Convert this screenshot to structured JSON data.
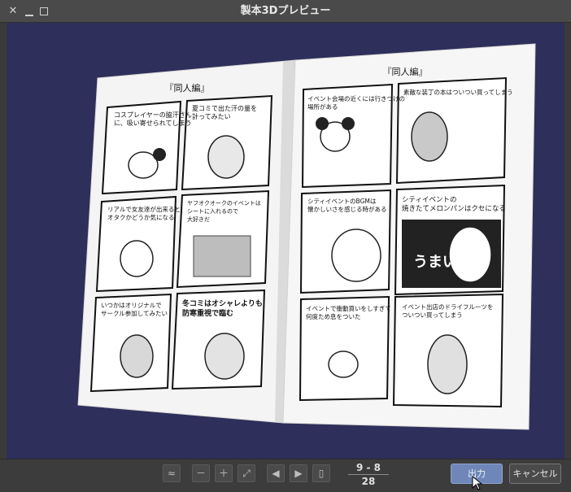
{
  "window": {
    "title": "製本3Dプレビュー",
    "close_icon": "close-icon",
    "minimize_icon": "minimize-icon",
    "maximize_icon": "maximize-icon"
  },
  "book": {
    "left_page": {
      "header": "『同人編』",
      "panels": [
        "コスプレイヤーの脇汗さん\nに、吸い寄せられてしまう",
        "夏コミで出た汗の量を\n計ってみたい",
        "リアルで女友達が出来ると、\nオタクかどうか気になる",
        "ヤフオクオークのイベントは\nシートに入れるので\n大好きだ",
        "いつかはオリジナルで\nサークル参加してみたい",
        "冬コミはオシャレよりも\n防寒重視で臨む"
      ]
    },
    "right_page": {
      "header": "『同人編』",
      "panels": [
        "イベント会場の近くには行きつけの\n場所がある",
        "素敵な装丁の本はついつい買ってしまう",
        "シティイベントのBGMは\n懐かしいさを感じる時がある",
        "シティイベントの\n焼きたてメロンパンはクセになる",
        "イベントで衝動買いをしすぎて\n何度ため息をついた",
        "イベント出店のドライフルーツを\nついつい買ってしまう"
      ],
      "sfx": "うまい"
    }
  },
  "toolbar": {
    "page_current": "9 - 8",
    "page_total": "28",
    "output_label": "出力",
    "cancel_label": "キャンセル"
  },
  "colors": {
    "viewport_bg": "#2e2f5a",
    "primary_button": "#6f87b8"
  }
}
